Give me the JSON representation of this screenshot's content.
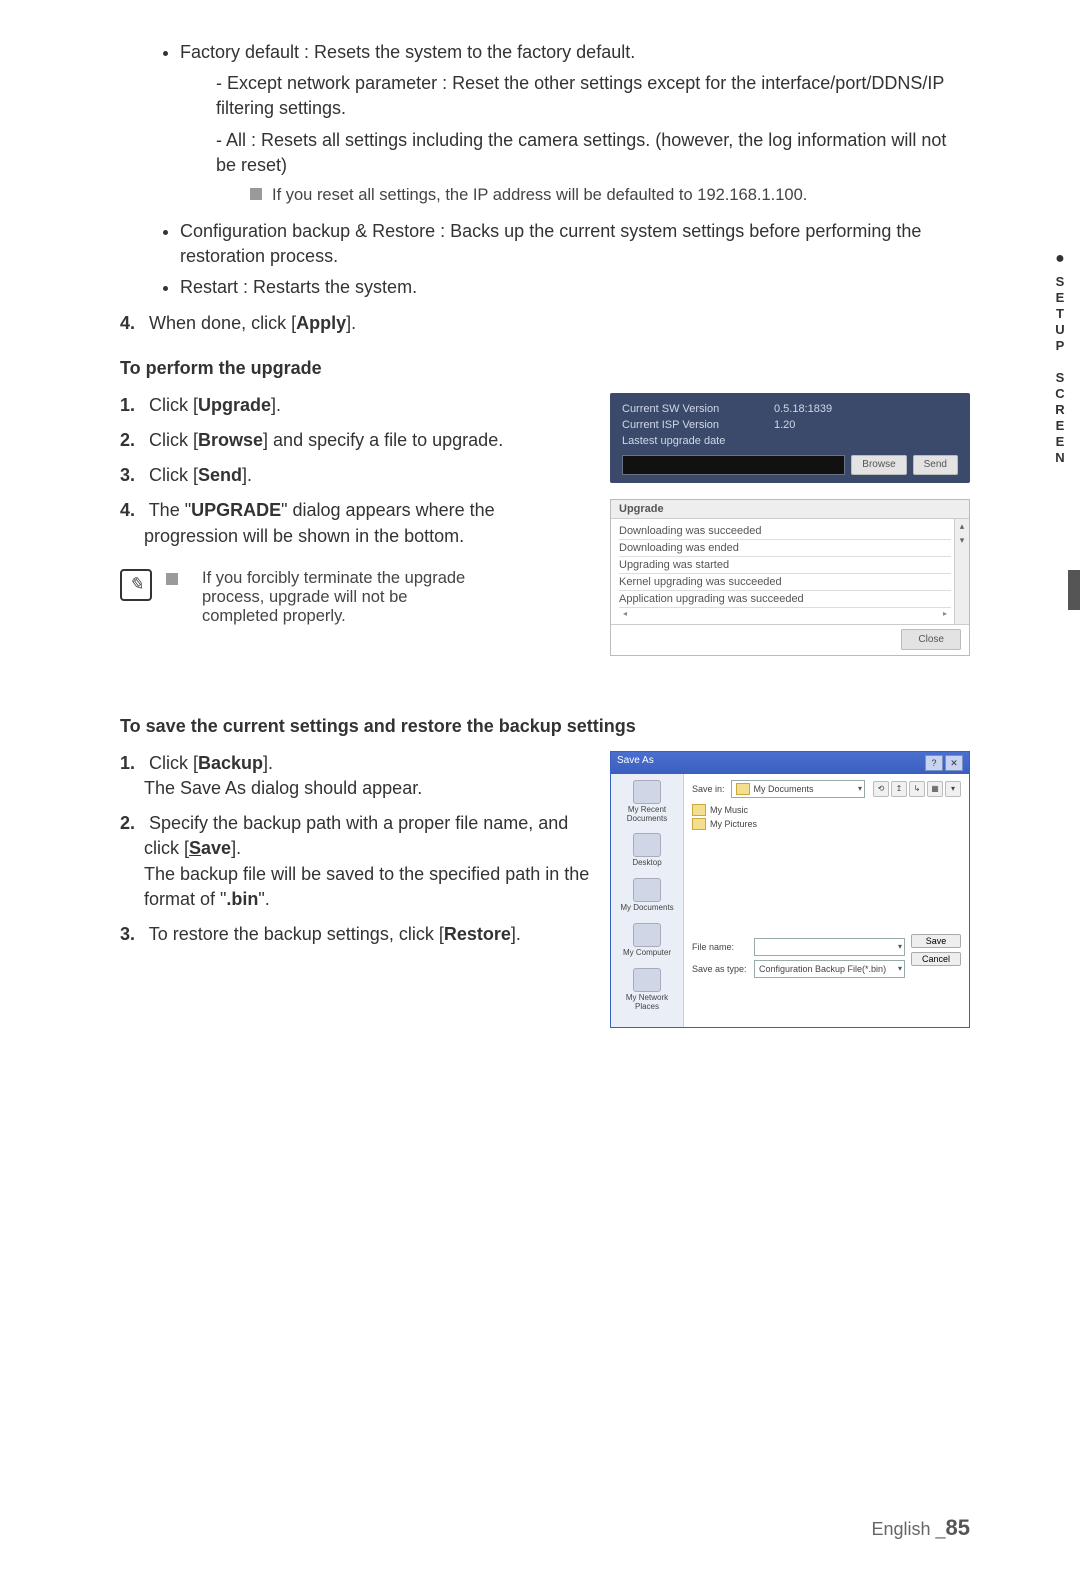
{
  "sideTab": {
    "dot": "●",
    "label": "SETUP SCREEN"
  },
  "bullets": {
    "factoryDefault": "Factory default : Resets the system to the factory default.",
    "dash1": "Except network parameter : Reset the other settings except for the interface/port/DDNS/IP filtering settings.",
    "dash2": "All : Resets all settings including the camera settings. (however, the log information will not be reset)",
    "resetNote": "If you reset all settings, the IP address will be defaulted to 192.168.1.100.",
    "configBackup": "Configuration backup & Restore : Backs up the current system settings before performing the restoration process.",
    "restart": "Restart : Restarts the system."
  },
  "step4": {
    "prefix": "When done, click [",
    "bold": "Apply",
    "suffix": "]."
  },
  "upgradeTitle": "To perform the upgrade",
  "upgradeSteps": {
    "s1": {
      "prefix": "Click [",
      "bold": "Upgrade",
      "suffix": "]."
    },
    "s2": {
      "prefix": "Click [",
      "bold": "Browse",
      "suffix": "] and specify a file to upgrade."
    },
    "s3": {
      "prefix": "Click [",
      "bold": "Send",
      "suffix": "]."
    },
    "s4": {
      "prefix": "The \"",
      "bold": "UPGRADE",
      "suffix": "\" dialog appears where the progression will be shown in the bottom."
    }
  },
  "upgradeTip": "If you forcibly terminate the upgrade process, upgrade will not be completed properly.",
  "upgradePanel": {
    "row1lbl": "Current SW Version",
    "row1val": "0.5.18:1839",
    "row2lbl": "Current ISP Version",
    "row2val": "1.20",
    "row3lbl": "Lastest upgrade date",
    "row3val": "",
    "browse": "Browse",
    "send": "Send",
    "boxTitle": "Upgrade",
    "l1": "Downloading was succeeded",
    "l2": "Downloading was ended",
    "l3": "Upgrading was started",
    "l4": "Kernel upgrading was succeeded",
    "l5": "Application upgrading was succeeded",
    "close": "Close"
  },
  "backupTitle": "To save the current settings and restore the backup settings",
  "backupSteps": {
    "s1a": "Click [",
    "s1b": "Backup",
    "s1c": "].",
    "s1d": "The Save As dialog should appear.",
    "s2a": "Specify the backup path with a proper file name, and click [",
    "s2b": "S",
    "s2c": "ave",
    "s2d": "].",
    "s2e1": "The backup file will be saved to the specified path in the format of \"",
    "s2e2": ".bin",
    "s2e3": "\".",
    "s3a": "To restore the backup settings, click [",
    "s3b": "Restore",
    "s3c": "]."
  },
  "saveAs": {
    "title": "Save As",
    "help": "?",
    "close": "✕",
    "saveInLbl": "Save in:",
    "saveInVal": "My Documents",
    "tools": {
      "a": "⟲",
      "b": "↥",
      "c": "↳",
      "d": "▦",
      "e": "▾"
    },
    "places": {
      "p1": "My Recent Documents",
      "p2": "Desktop",
      "p3": "My Documents",
      "p4": "My Computer",
      "p5": "My Network Places"
    },
    "files": {
      "f1": "My Music",
      "f2": "My Pictures"
    },
    "fileNameLbl": "File name:",
    "fileNameVal": "",
    "saveTypeLbl": "Save as type:",
    "saveTypeVal": "Configuration Backup File(*.bin)",
    "saveBtnU": "S",
    "saveBtn": "ave",
    "cancelBtn": "Cancel"
  },
  "footer": {
    "lang": "English _",
    "page": "85"
  }
}
